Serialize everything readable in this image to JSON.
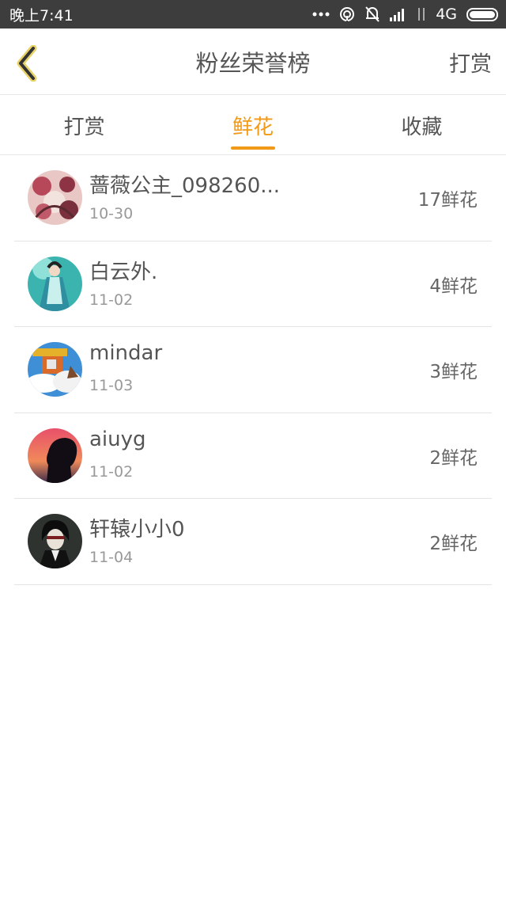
{
  "status_bar": {
    "time": "晚上7:41",
    "network": "4G",
    "icons": [
      "dots-icon",
      "hotspot-icon",
      "mute-bell-icon",
      "signal-icon",
      "data-arrows-icon",
      "battery-icon"
    ]
  },
  "header": {
    "title": "粉丝荣誉榜",
    "action_label": "打赏",
    "back_icon": "chevron-left-icon",
    "accent": "#f19a18"
  },
  "tabs": [
    {
      "label": "打赏",
      "active": false
    },
    {
      "label": "鲜花",
      "active": true
    },
    {
      "label": "收藏",
      "active": false
    }
  ],
  "fans": [
    {
      "name": "蔷薇公主_098260...",
      "date": "10-30",
      "count": "17鲜花",
      "avatar": "pink-floral-avatar"
    },
    {
      "name": "白云外.",
      "date": "11-02",
      "count": "4鲜花",
      "avatar": "teal-figure-avatar"
    },
    {
      "name": "mindar",
      "date": "11-03",
      "count": "3鲜花",
      "avatar": "cartoon-sky-avatar"
    },
    {
      "name": "aiuyg",
      "date": "11-02",
      "count": "2鲜花",
      "avatar": "sunset-silhouette-avatar"
    },
    {
      "name": "轩辕小小0",
      "date": "11-04",
      "count": "2鲜花",
      "avatar": "dark-anime-avatar"
    }
  ]
}
